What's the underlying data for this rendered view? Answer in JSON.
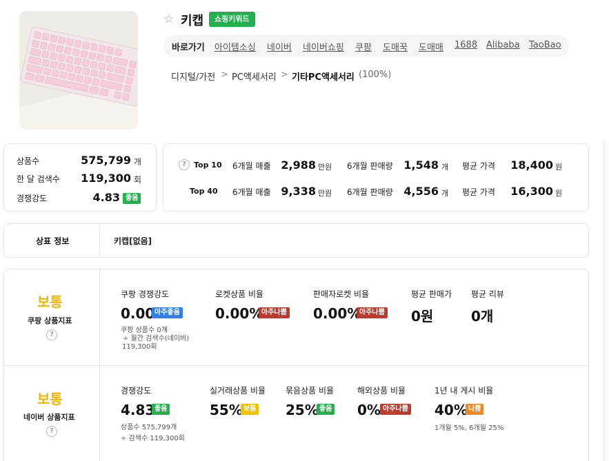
{
  "header": {
    "keyword": "키캡",
    "keyword_badge": "쇼핑키워드",
    "quicklinks_label": "바로가기",
    "quicklinks": [
      "아이템소싱",
      "네이버",
      "네이버쇼핑",
      "쿠팡",
      "도매꾹",
      "도매매",
      "1688",
      "Alibaba",
      "TaoBao"
    ],
    "breadcrumb": [
      "디지털/가전",
      "PC액세서리",
      "기타PC액세서리"
    ],
    "breadcrumb_sep": ">",
    "breadcrumb_pct": "(100%)"
  },
  "summary": {
    "products_label": "상품수",
    "products_value": "575,799",
    "products_unit": "개",
    "search_label": "한 달 검색수",
    "search_value": "119,300",
    "search_unit": "회",
    "comp_label": "경쟁강도",
    "comp_value": "4.83",
    "comp_badge": "좋음"
  },
  "top": {
    "rows": [
      {
        "label": "Top 10",
        "sales_label": "6개월 매출",
        "sales": "2,988",
        "sales_unit": "만원",
        "qty_label": "6개월 판매량",
        "qty": "1,548",
        "qty_unit": "개",
        "price_label": "평균 가격",
        "price": "18,400",
        "price_unit": "원"
      },
      {
        "label": "Top 40",
        "sales_label": "6개월 매출",
        "sales": "9,338",
        "sales_unit": "만원",
        "qty_label": "6개월 판매량",
        "qty": "4,556",
        "qty_unit": "개",
        "price_label": "평균 가격",
        "price": "16,300",
        "price_unit": "원"
      }
    ]
  },
  "trademark": {
    "label": "상표 정보",
    "value": "키캡[없음]"
  },
  "coupang": {
    "grade": "보통",
    "title": "쿠팡 상품지표",
    "m1_title": "쿠팡 경쟁강도",
    "m1_value": "0.00",
    "m1_badge": "아주좋음",
    "m1_note1": "쿠팡 상품수 0개",
    "m1_note2": "÷ 월간 검색수(네이버)",
    "m1_note3": "119,300회",
    "m2_title": "로켓상품 비율",
    "m2_value": "0.00%",
    "m2_badge": "아주나쁨",
    "m3_title": "판매자로켓 비율",
    "m3_value": "0.00%",
    "m3_badge": "아주나쁨",
    "m4_title": "평균 판매가",
    "m4_value": "0원",
    "m5_title": "평균 리뷰",
    "m5_value": "0개"
  },
  "naver": {
    "grade": "보통",
    "title": "네이버 상품지표",
    "m1_title": "경쟁강도",
    "m1_value": "4.83",
    "m1_badge": "좋음",
    "m1_note1": "상품수 575,799개",
    "m1_note2": "÷ 검색수 119,300회",
    "m2_title": "실거래상품 비율",
    "m2_value": "55%",
    "m2_badge": "보통",
    "m3_title": "묶음상품 비율",
    "m3_value": "25%",
    "m3_badge": "좋음",
    "m4_title": "해외상품 비율",
    "m4_value": "0%",
    "m4_badge": "아주나쁨",
    "m5_title": "1년 내 게시 비율",
    "m5_value": "40%",
    "m5_badge": "나쁨",
    "m5_note": "1개월 5%, 6개월 25%"
  },
  "colors": {
    "good": "#22b14c",
    "very_good": "#2f80ed",
    "very_bad": "#c0392b",
    "normal": "#f2c200",
    "bad": "#f08a24",
    "grade": "#f5b400"
  }
}
